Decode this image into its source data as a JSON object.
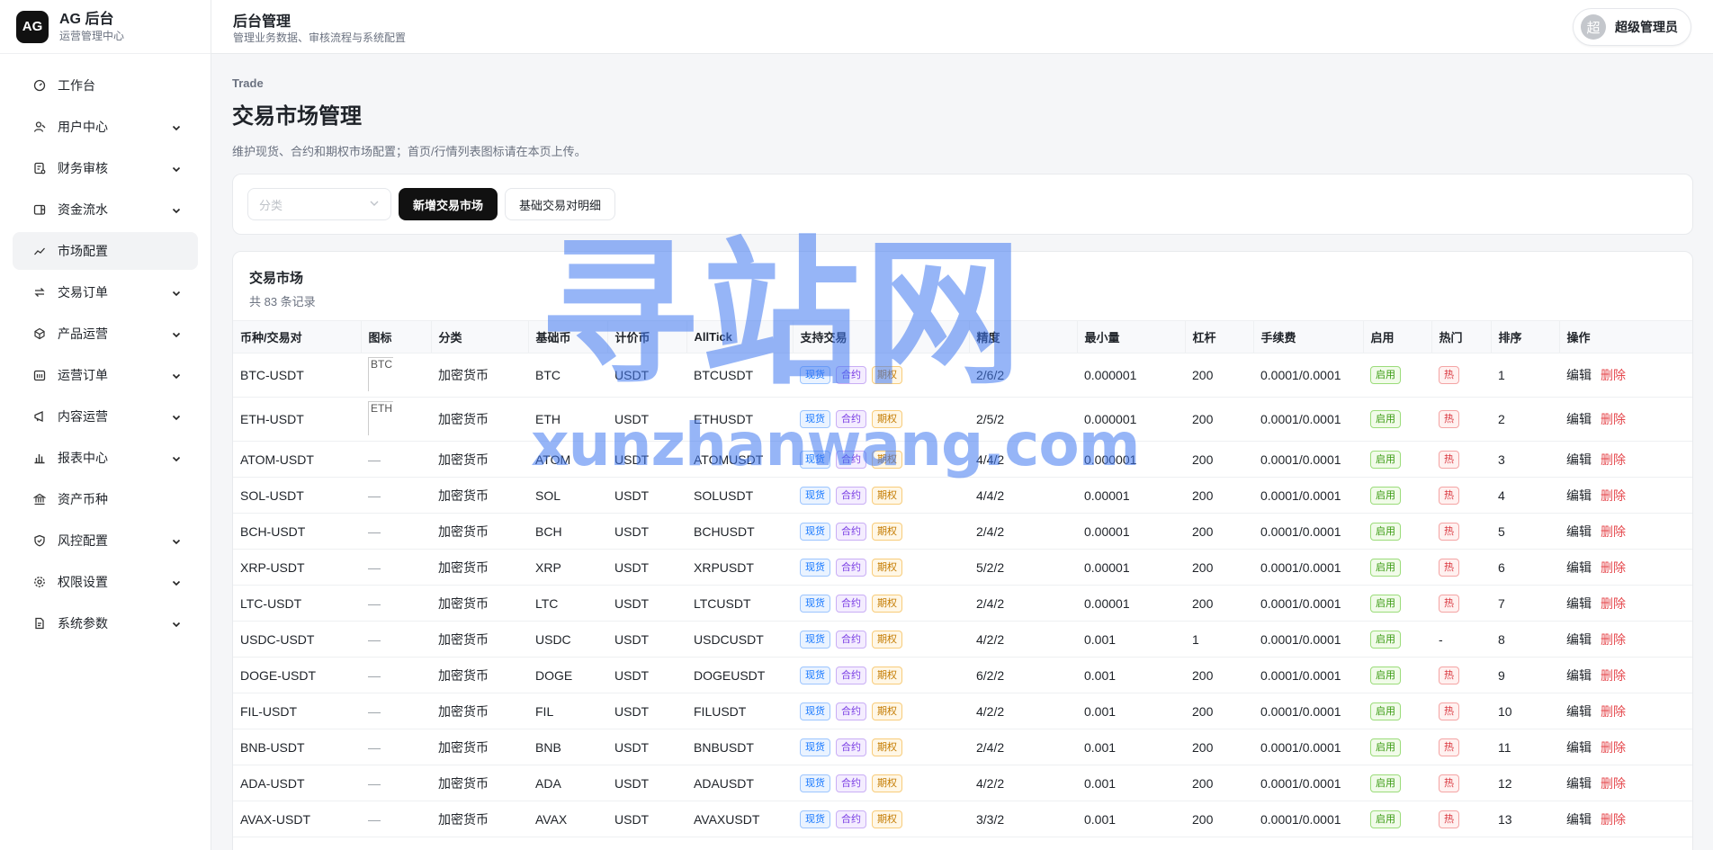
{
  "brand": {
    "logo": "AG",
    "title": "AG 后台",
    "subtitle": "运营管理中心"
  },
  "sidebar": {
    "items": [
      {
        "label": "工作台",
        "icon": "dashboard-icon",
        "expandable": false,
        "active": false
      },
      {
        "label": "用户中心",
        "icon": "user-icon",
        "expandable": true,
        "active": false
      },
      {
        "label": "财务审核",
        "icon": "audit-icon",
        "expandable": true,
        "active": false
      },
      {
        "label": "资金流水",
        "icon": "wallet-icon",
        "expandable": true,
        "active": false
      },
      {
        "label": "市场配置",
        "icon": "chart-line-icon",
        "expandable": false,
        "active": true
      },
      {
        "label": "交易订单",
        "icon": "swap-icon",
        "expandable": true,
        "active": false
      },
      {
        "label": "产品运营",
        "icon": "cube-icon",
        "expandable": true,
        "active": false
      },
      {
        "label": "运营订单",
        "icon": "calendar-icon",
        "expandable": true,
        "active": false
      },
      {
        "label": "内容运营",
        "icon": "megaphone-icon",
        "expandable": true,
        "active": false
      },
      {
        "label": "报表中心",
        "icon": "bar-chart-icon",
        "expandable": true,
        "active": false
      },
      {
        "label": "资产币种",
        "icon": "bank-icon",
        "expandable": false,
        "active": false
      },
      {
        "label": "风控配置",
        "icon": "shield-icon",
        "expandable": true,
        "active": false
      },
      {
        "label": "权限设置",
        "icon": "gear-icon",
        "expandable": true,
        "active": false
      },
      {
        "label": "系统参数",
        "icon": "document-icon",
        "expandable": true,
        "active": false
      }
    ]
  },
  "topbar": {
    "title": "后台管理",
    "subtitle": "管理业务数据、审核流程与系统配置"
  },
  "user": {
    "avatar": "超",
    "name": "超级管理员"
  },
  "page": {
    "breadcrumb": "Trade",
    "title": "交易市场管理",
    "description": "维护现货、合约和期权市场配置；首页/行情列表图标请在本页上传。"
  },
  "toolbar": {
    "category_placeholder": "分类",
    "add_label": "新增交易市场",
    "detail_label": "基础交易对明细"
  },
  "table": {
    "title": "交易市场",
    "count": "共 83 条记录",
    "columns": [
      "币种/交易对",
      "图标",
      "分类",
      "基础币",
      "计价币",
      "AllTick",
      "支持交易",
      "精度",
      "最小量",
      "杠杆",
      "手续费",
      "启用",
      "热门",
      "排序",
      "操作"
    ],
    "tags": {
      "spot": "现货",
      "swap": "合约",
      "option": "期权",
      "enabled": "启用",
      "hot": "热"
    },
    "actions": {
      "edit": "编辑",
      "delete": "删除"
    },
    "empty_icon": "—",
    "not_hot": "-",
    "rows": [
      {
        "pair": "BTC-USDT",
        "icon_alt": "BTC",
        "category": "加密货币",
        "base": "BTC",
        "quote": "USDT",
        "alltick": "BTCUSDT",
        "precision": "2/6/2",
        "min_qty": "0.000001",
        "leverage": "200",
        "fee": "0.0001/0.0001",
        "hot": true,
        "sort": "1"
      },
      {
        "pair": "ETH-USDT",
        "icon_alt": "ETH",
        "category": "加密货币",
        "base": "ETH",
        "quote": "USDT",
        "alltick": "ETHUSDT",
        "precision": "2/5/2",
        "min_qty": "0.000001",
        "leverage": "200",
        "fee": "0.0001/0.0001",
        "hot": true,
        "sort": "2"
      },
      {
        "pair": "ATOM-USDT",
        "icon_alt": "",
        "category": "加密货币",
        "base": "ATOM",
        "quote": "USDT",
        "alltick": "ATOMUSDT",
        "precision": "4/4/2",
        "min_qty": "0.000001",
        "leverage": "200",
        "fee": "0.0001/0.0001",
        "hot": true,
        "sort": "3"
      },
      {
        "pair": "SOL-USDT",
        "icon_alt": "",
        "category": "加密货币",
        "base": "SOL",
        "quote": "USDT",
        "alltick": "SOLUSDT",
        "precision": "4/4/2",
        "min_qty": "0.00001",
        "leverage": "200",
        "fee": "0.0001/0.0001",
        "hot": true,
        "sort": "4"
      },
      {
        "pair": "BCH-USDT",
        "icon_alt": "",
        "category": "加密货币",
        "base": "BCH",
        "quote": "USDT",
        "alltick": "BCHUSDT",
        "precision": "2/4/2",
        "min_qty": "0.00001",
        "leverage": "200",
        "fee": "0.0001/0.0001",
        "hot": true,
        "sort": "5"
      },
      {
        "pair": "XRP-USDT",
        "icon_alt": "",
        "category": "加密货币",
        "base": "XRP",
        "quote": "USDT",
        "alltick": "XRPUSDT",
        "precision": "5/2/2",
        "min_qty": "0.00001",
        "leverage": "200",
        "fee": "0.0001/0.0001",
        "hot": true,
        "sort": "6"
      },
      {
        "pair": "LTC-USDT",
        "icon_alt": "",
        "category": "加密货币",
        "base": "LTC",
        "quote": "USDT",
        "alltick": "LTCUSDT",
        "precision": "2/4/2",
        "min_qty": "0.00001",
        "leverage": "200",
        "fee": "0.0001/0.0001",
        "hot": true,
        "sort": "7"
      },
      {
        "pair": "USDC-USDT",
        "icon_alt": "",
        "category": "加密货币",
        "base": "USDC",
        "quote": "USDT",
        "alltick": "USDCUSDT",
        "precision": "4/2/2",
        "min_qty": "0.001",
        "leverage": "1",
        "fee": "0.0001/0.0001",
        "hot": false,
        "sort": "8"
      },
      {
        "pair": "DOGE-USDT",
        "icon_alt": "",
        "category": "加密货币",
        "base": "DOGE",
        "quote": "USDT",
        "alltick": "DOGEUSDT",
        "precision": "6/2/2",
        "min_qty": "0.001",
        "leverage": "200",
        "fee": "0.0001/0.0001",
        "hot": true,
        "sort": "9"
      },
      {
        "pair": "FIL-USDT",
        "icon_alt": "",
        "category": "加密货币",
        "base": "FIL",
        "quote": "USDT",
        "alltick": "FILUSDT",
        "precision": "4/2/2",
        "min_qty": "0.001",
        "leverage": "200",
        "fee": "0.0001/0.0001",
        "hot": true,
        "sort": "10"
      },
      {
        "pair": "BNB-USDT",
        "icon_alt": "",
        "category": "加密货币",
        "base": "BNB",
        "quote": "USDT",
        "alltick": "BNBUSDT",
        "precision": "2/4/2",
        "min_qty": "0.001",
        "leverage": "200",
        "fee": "0.0001/0.0001",
        "hot": true,
        "sort": "11"
      },
      {
        "pair": "ADA-USDT",
        "icon_alt": "",
        "category": "加密货币",
        "base": "ADA",
        "quote": "USDT",
        "alltick": "ADAUSDT",
        "precision": "4/2/2",
        "min_qty": "0.001",
        "leverage": "200",
        "fee": "0.0001/0.0001",
        "hot": true,
        "sort": "12"
      },
      {
        "pair": "AVAX-USDT",
        "icon_alt": "",
        "category": "加密货币",
        "base": "AVAX",
        "quote": "USDT",
        "alltick": "AVAXUSDT",
        "precision": "3/3/2",
        "min_qty": "0.001",
        "leverage": "200",
        "fee": "0.0001/0.0001",
        "hot": true,
        "sort": "13"
      }
    ]
  },
  "watermark": {
    "cn": "寻站网",
    "en": "xunzhanwang.com"
  }
}
